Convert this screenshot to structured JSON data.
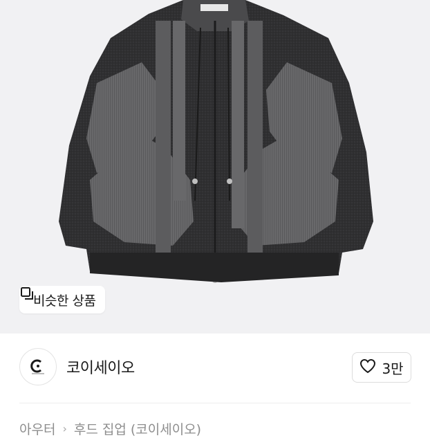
{
  "product_image": {
    "alt_icon": "hoodie-photo"
  },
  "similar_button": {
    "label": "비슷한 상품",
    "icon": "copy-icon"
  },
  "seller": {
    "name": "코이세이오",
    "avatar_icon": "brand-logo"
  },
  "like": {
    "count": "3만",
    "icon": "heart-outline-icon"
  },
  "breadcrumb": {
    "items": [
      "아우터",
      "후드 집업 (코이세이오)"
    ],
    "separator_icon": "chevron-right-icon"
  }
}
